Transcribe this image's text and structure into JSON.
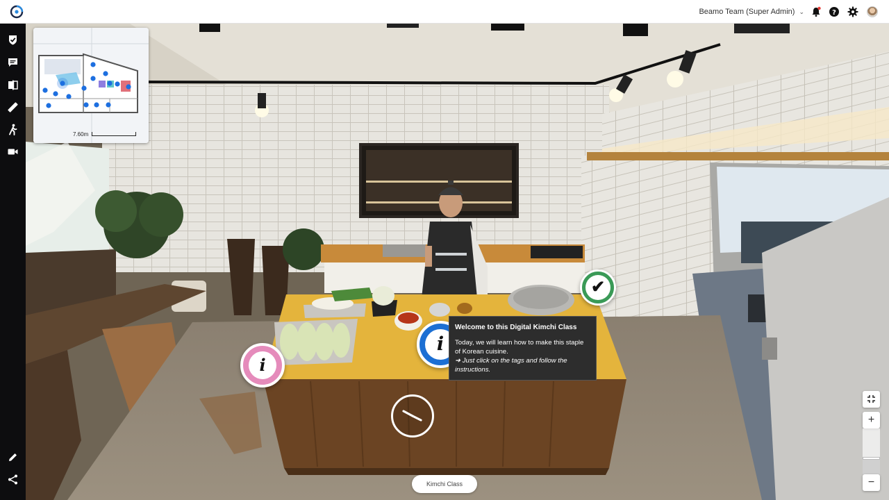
{
  "header": {
    "team_label": "Beamo Team (Super Admin)",
    "logo_icon": "beamo-logo-icon",
    "icons": [
      "bell-icon",
      "help-icon",
      "gear-icon",
      "avatar"
    ],
    "notification_color": "#e53935"
  },
  "toolbar": {
    "tools": [
      "checkbox-shield-icon",
      "comment-icon",
      "compare-icon",
      "measure-ruler-icon",
      "walk-person-icon",
      "video-icon"
    ],
    "bottom_tools": [
      "pencil-icon",
      "share-icon"
    ]
  },
  "minimap": {
    "scale_label": "7.60m"
  },
  "hotspots": {
    "colors": {
      "pink": "#e58bbb",
      "blue": "#1c6fd3",
      "green": "#3a9a57"
    }
  },
  "tooltip": {
    "title": "Welcome to this Digital Kimchi Class",
    "body": "Today, we will learn how to make this staple of Korean cuisine.",
    "note": "➜ Just click on the tags and follow the instructions."
  },
  "scene_label": "Kimchi Class",
  "zoom": {
    "level": 0.35
  }
}
